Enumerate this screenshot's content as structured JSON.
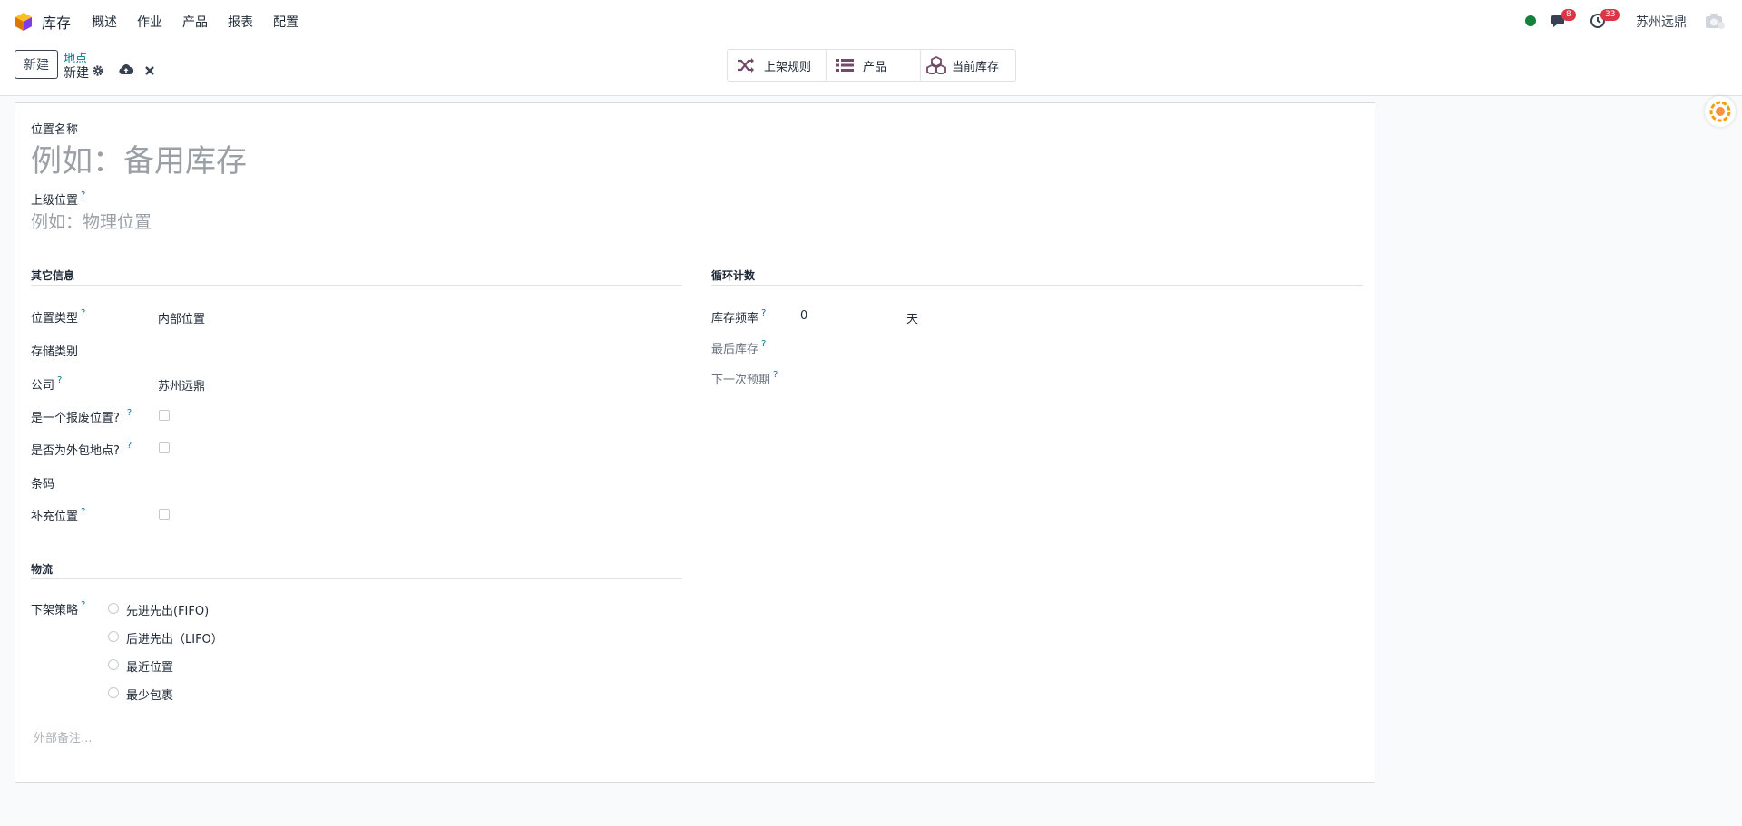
{
  "navbar": {
    "app_title": "库存",
    "menu": [
      "概述",
      "作业",
      "产品",
      "报表",
      "配置"
    ],
    "messages_count": "8",
    "activities_count": "33",
    "company": "苏州远鼎"
  },
  "control": {
    "new_button": "新建",
    "breadcrumb": "地点",
    "record_name": "新建",
    "smart_buttons": [
      "上架规则",
      "产品",
      "当前库存"
    ]
  },
  "form": {
    "name_label": "位置名称",
    "name_placeholder": "例如：备用库存",
    "parent_label": "上级位置",
    "parent_placeholder": "例如：物理位置",
    "help_mark": "?",
    "other_info": {
      "title": "其它信息",
      "location_type_label": "位置类型",
      "location_type_value": "内部位置",
      "storage_category_label": "存储类别",
      "company_label": "公司",
      "company_value": "苏州远鼎",
      "scrap_label": "是一个报废位置?",
      "subcontract_label": "是否为外包地点?",
      "barcode_label": "条码",
      "replenish_label": "补充位置"
    },
    "cyclic": {
      "title": "循环计数",
      "frequency_label": "库存频率",
      "frequency_value": "0",
      "frequency_unit": "天",
      "last_inventory_label": "最后库存",
      "next_expected_label": "下一次预期"
    },
    "logistics": {
      "title": "物流",
      "removal_label": "下架策略",
      "options": [
        "先进先出(FIFO)",
        "后进先出（LIFO）",
        "最近位置",
        "最少包裹"
      ]
    },
    "note_placeholder": "外部备注..."
  },
  "colors": {
    "accent": "#017e84",
    "badge": "#dc3545",
    "status": "#15803d",
    "icon": "#714b67"
  }
}
